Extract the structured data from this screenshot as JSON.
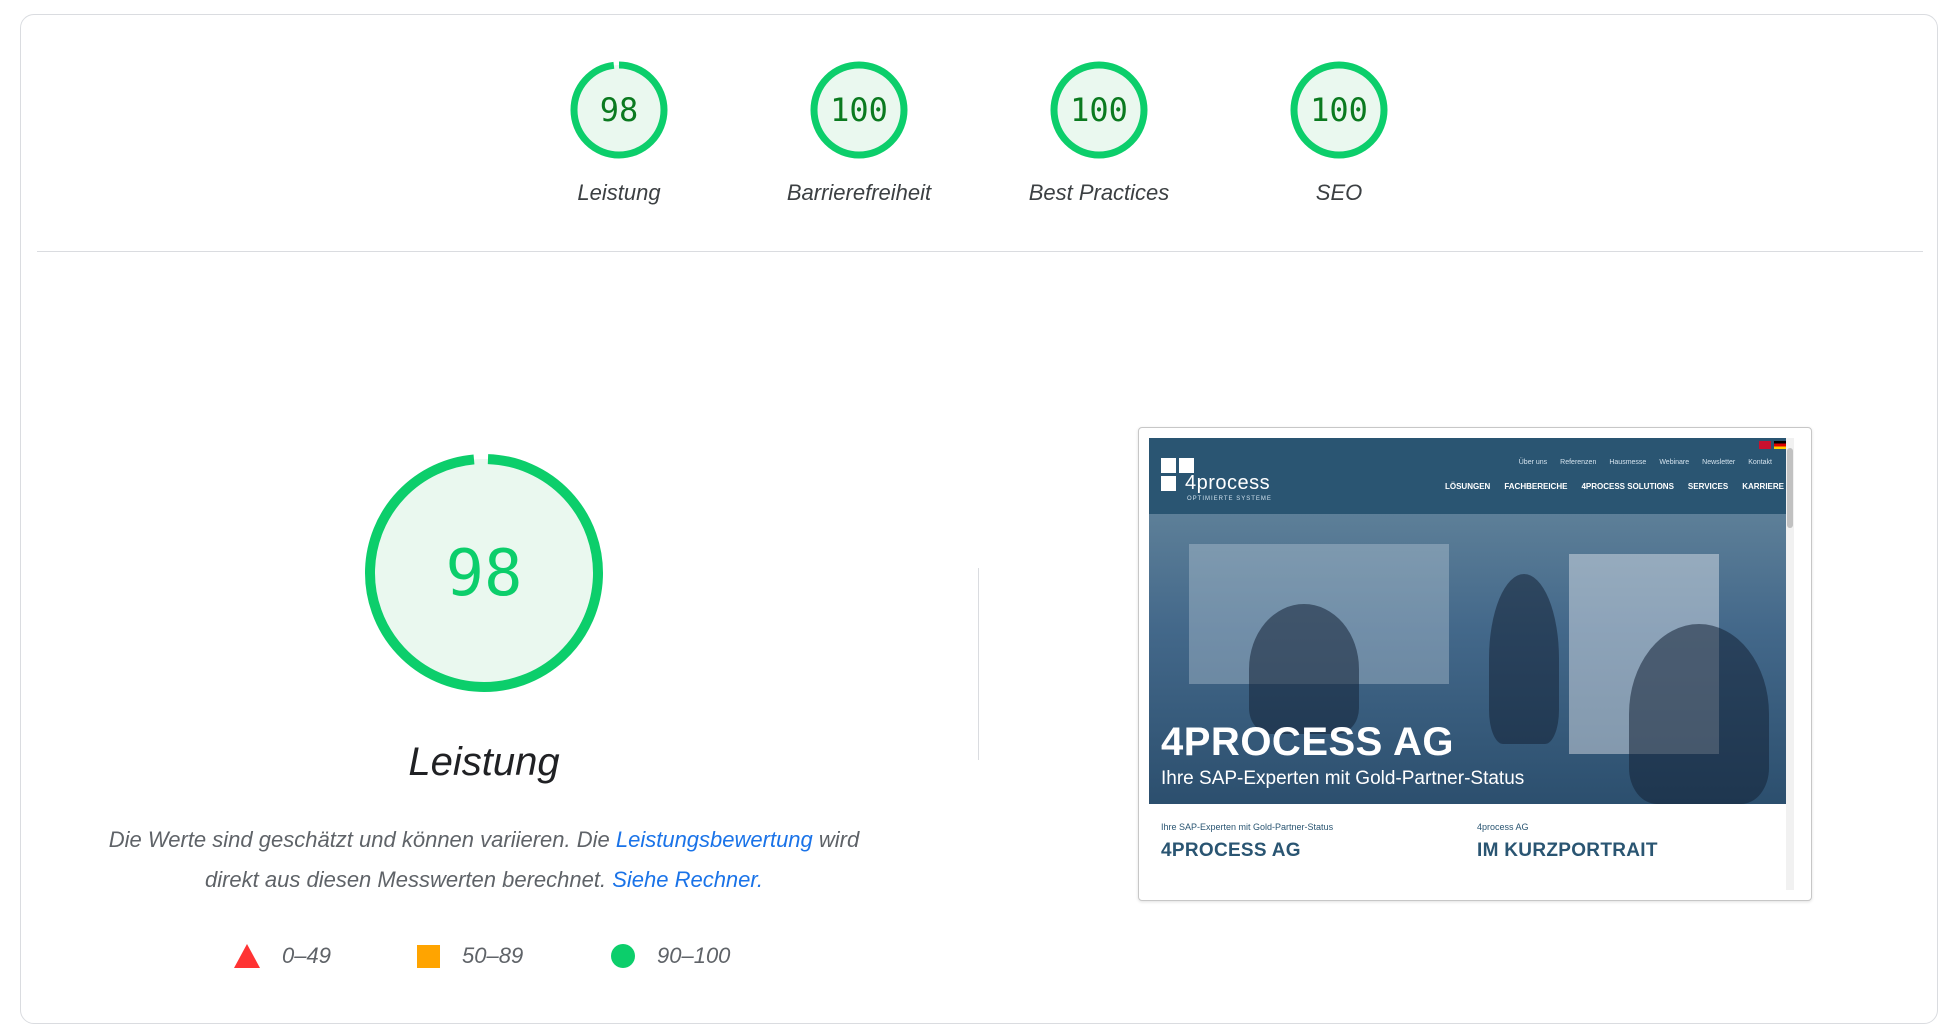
{
  "categories": [
    {
      "score": "98",
      "label": "Leistung",
      "fraction": 0.98
    },
    {
      "score": "100",
      "label": "Barrierefreiheit",
      "fraction": 1.0
    },
    {
      "score": "100",
      "label": "Best Practices",
      "fraction": 1.0
    },
    {
      "score": "100",
      "label": "SEO",
      "fraction": 1.0
    }
  ],
  "performance": {
    "score": "98",
    "fraction": 0.98,
    "title": "Leistung",
    "desc_pre": "Die Werte sind geschätzt und können variieren. Die ",
    "desc_link1": "Leistungsbewertung",
    "desc_mid": " wird direkt aus diesen Messwerten berechnet. ",
    "desc_link2": "Siehe Rechner."
  },
  "legend": [
    {
      "range": "0–49",
      "shape": "triangle",
      "color": "#ff3333"
    },
    {
      "range": "50–89",
      "shape": "square",
      "color": "#ffa400"
    },
    {
      "range": "90–100",
      "shape": "circle",
      "color": "#0cce6b"
    }
  ],
  "colors": {
    "pass": "#0cce6b",
    "pass_fill": "#eaf8ef",
    "pass_text": "#0b7a20",
    "link": "#1a73e8"
  },
  "screenshot": {
    "logo_text": "4process",
    "logo_sub": "OPTIMIERTE SYSTEME",
    "topnav": [
      "Über uns",
      "Referenzen",
      "Hausmesse",
      "Webinare",
      "Newsletter",
      "Kontakt"
    ],
    "mainnav": [
      "LÖSUNGEN",
      "FACHBEREICHE",
      "4PROCESS SOLUTIONS",
      "SERVICES",
      "KARRIERE"
    ],
    "hero_title": "4PROCESS AG",
    "hero_subtitle": "Ihre SAP-Experten mit Gold-Partner-Status",
    "teaser_left_small": "Ihre SAP-Experten mit Gold-Partner-Status",
    "teaser_left_big": "4PROCESS AG",
    "teaser_right_small": "4process AG",
    "teaser_right_big": "IM KURZPORTRAIT"
  }
}
